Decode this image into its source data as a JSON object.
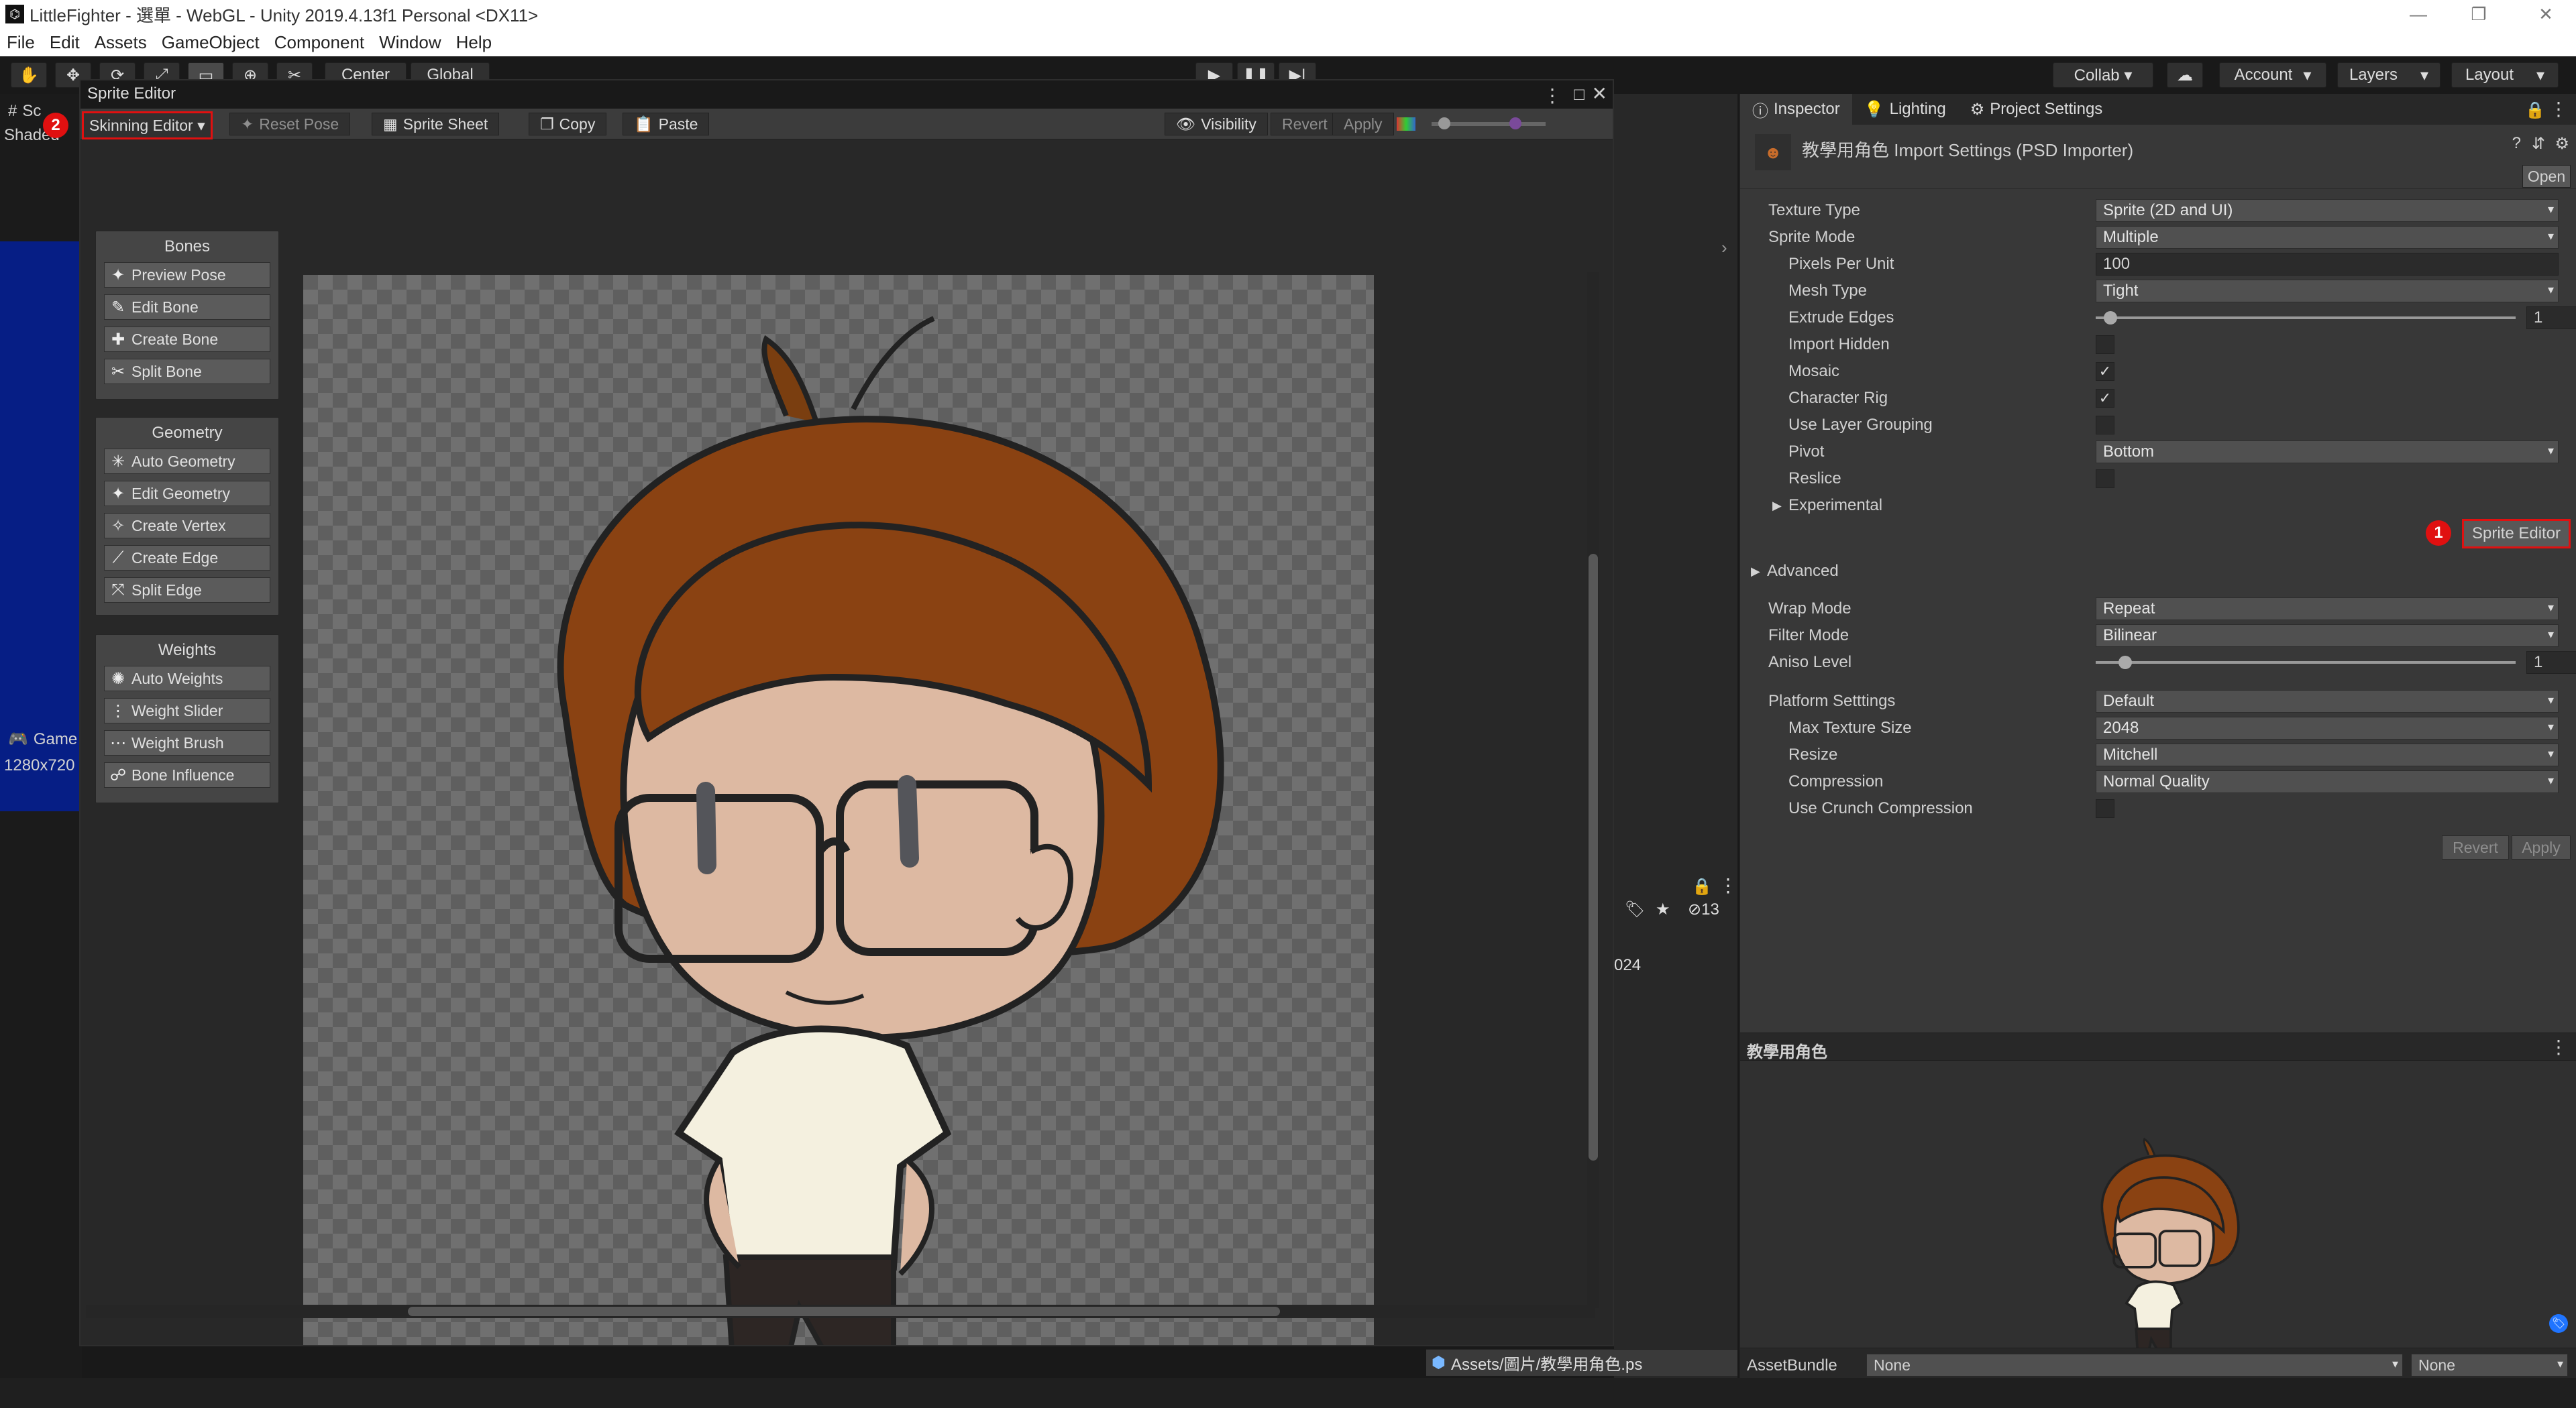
{
  "window": {
    "title": "LittleFighter - 選單 - WebGL - Unity 2019.4.13f1 Personal <DX11>",
    "controls": {
      "minimize": "—",
      "restore": "❐",
      "close": "✕"
    }
  },
  "menubar": {
    "items": [
      "File",
      "Edit",
      "Assets",
      "GameObject",
      "Component",
      "Window",
      "Help"
    ]
  },
  "toolbar": {
    "center_toggle": "Center",
    "global_toggle": "Global",
    "collab": "Collab ▾",
    "account": "Account",
    "layers": "Layers",
    "layout": "Layout"
  },
  "left_panel": {
    "scene_tab": "Sc",
    "shaded": "Shaded",
    "game_tab": "Game",
    "resolution": "1280x720"
  },
  "sprite_editor": {
    "title": "Sprite Editor",
    "mode_dropdown": "Skinning Editor ▾",
    "badge": "2",
    "toolbar": {
      "reset_pose": "Reset Pose",
      "sprite_sheet": "Sprite Sheet",
      "copy": "Copy",
      "paste": "Paste",
      "visibility": "Visibility",
      "revert": "Revert",
      "apply": "Apply"
    },
    "groups": [
      {
        "title": "Bones",
        "items": [
          "Preview Pose",
          "Edit Bone",
          "Create Bone",
          "Split Bone"
        ]
      },
      {
        "title": "Geometry",
        "items": [
          "Auto Geometry",
          "Edit Geometry",
          "Create Vertex",
          "Create Edge",
          "Split Edge"
        ]
      },
      {
        "title": "Weights",
        "items": [
          "Auto Weights",
          "Weight Slider",
          "Weight Brush",
          "Bone Influence"
        ]
      }
    ]
  },
  "middle_panel": {
    "count_text": "13",
    "date_text": "024",
    "asset_path": "Assets/圖片/教學用角色.ps"
  },
  "inspector": {
    "tabs": [
      "Inspector",
      "Lighting",
      "Project Settings"
    ],
    "header_title": "教學用角色 Import Settings (PSD Importer)",
    "open_button": "Open",
    "rows": [
      {
        "label": "Texture Type",
        "value": "Sprite (2D and UI)",
        "type": "dropdown"
      },
      {
        "label": "Sprite Mode",
        "value": "Multiple",
        "type": "dropdown"
      },
      {
        "label": "Pixels Per Unit",
        "value": "100",
        "type": "input",
        "indent": true
      },
      {
        "label": "Mesh Type",
        "value": "Tight",
        "type": "dropdown",
        "indent": true
      },
      {
        "label": "Extrude Edges",
        "value": "1",
        "type": "slider",
        "indent": true,
        "fraction": 0.02
      },
      {
        "label": "Import Hidden",
        "value": "",
        "type": "check",
        "indent": true,
        "checked": false
      },
      {
        "label": "Mosaic",
        "value": "",
        "type": "check",
        "indent": true,
        "checked": true
      },
      {
        "label": "Character Rig",
        "value": "",
        "type": "check",
        "indent": true,
        "checked": true
      },
      {
        "label": "Use Layer Grouping",
        "value": "",
        "type": "check",
        "indent": true,
        "checked": false
      },
      {
        "label": "Pivot",
        "value": "Bottom",
        "type": "dropdown",
        "indent": true
      },
      {
        "label": "Reslice",
        "value": "",
        "type": "check",
        "indent": true,
        "checked": false
      },
      {
        "label": "Experimental",
        "value": "",
        "type": "foldout",
        "indent": true
      }
    ],
    "sprite_editor_button": "Sprite Editor",
    "badge": "1",
    "advanced": "Advanced",
    "rows2": [
      {
        "label": "Wrap Mode",
        "value": "Repeat",
        "type": "dropdown"
      },
      {
        "label": "Filter Mode",
        "value": "Bilinear",
        "type": "dropdown"
      },
      {
        "label": "Aniso Level",
        "value": "1",
        "type": "slider",
        "fraction": 0.04
      }
    ],
    "rows3": [
      {
        "label": "Platform Setttings",
        "value": "Default",
        "type": "dropdown"
      },
      {
        "label": "Max Texture Size",
        "value": "2048",
        "type": "dropdown",
        "indent": true
      },
      {
        "label": "Resize",
        "value": "Mitchell",
        "type": "dropdown",
        "indent": true
      },
      {
        "label": "Compression",
        "value": "Normal Quality",
        "type": "dropdown",
        "indent": true
      },
      {
        "label": "Use Crunch Compression",
        "value": "",
        "type": "check",
        "indent": true,
        "checked": false
      }
    ],
    "revert_button": "Revert",
    "apply_button": "Apply",
    "preview_title": "教學用角色",
    "assetbundle_label": "AssetBundle",
    "assetbundle_value": "None",
    "assetbundle_variant": "None"
  }
}
